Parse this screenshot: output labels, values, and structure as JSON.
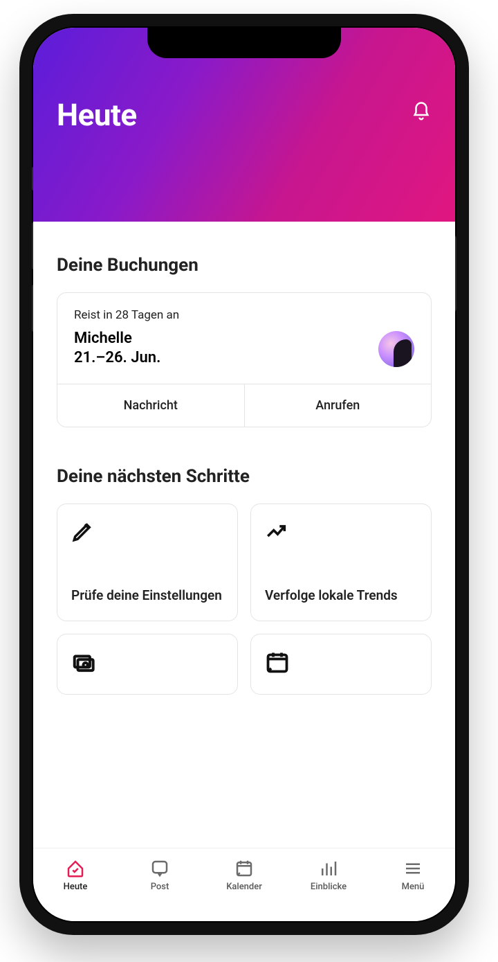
{
  "header": {
    "title": "Heute"
  },
  "bookings": {
    "section_title": "Deine Buchungen",
    "card": {
      "status": "Reist in 28 Tagen an",
      "guest_name": "Michelle",
      "date_range": "21.–26. Jun.",
      "message_label": "Nachricht",
      "call_label": "Anrufen"
    }
  },
  "next_steps": {
    "section_title": "Deine nächsten Schritte",
    "tiles": [
      {
        "label": "Prüfe deine Einstellungen"
      },
      {
        "label": "Verfolge lokale Trends"
      }
    ]
  },
  "tabs": [
    {
      "label": "Heute"
    },
    {
      "label": "Post"
    },
    {
      "label": "Kalender"
    },
    {
      "label": "Einblicke"
    },
    {
      "label": "Menü"
    }
  ]
}
